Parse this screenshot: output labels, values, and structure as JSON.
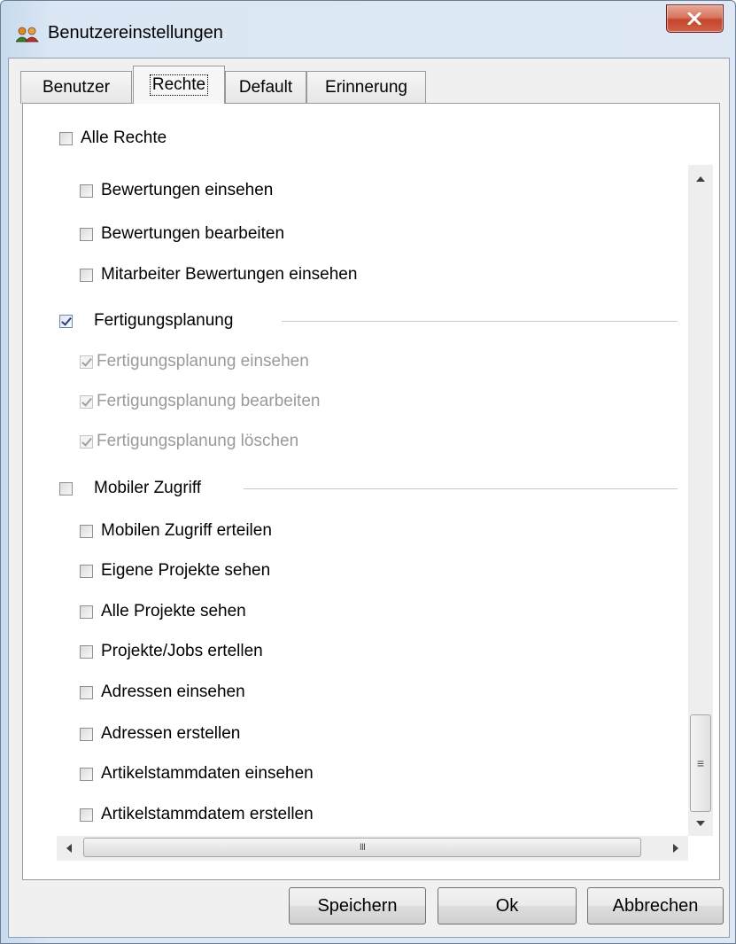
{
  "window": {
    "title": "Benutzereinstellungen",
    "icon": "users-icon",
    "close_icon": "close-icon"
  },
  "tabs": [
    {
      "label": "Benutzer",
      "active": false
    },
    {
      "label": "Rechte",
      "active": true
    },
    {
      "label": "Default",
      "active": false
    },
    {
      "label": "Erinnerung",
      "active": false
    }
  ],
  "all_rights": {
    "label": "Alle Rechte",
    "checked": false
  },
  "permissions": {
    "bewertungen_einsehen": {
      "label": "Bewertungen einsehen",
      "checked": false
    },
    "bewertungen_bearbeiten": {
      "label": "Bewertungen bearbeiten",
      "checked": false
    },
    "mitarbeiter_bewertungen": {
      "label": "Mitarbeiter Bewertungen einsehen",
      "checked": false
    }
  },
  "groups": {
    "fertigung": {
      "label": "Fertigungsplanung",
      "checked": true,
      "items": [
        {
          "label": "Fertigungsplanung einsehen",
          "checked": true,
          "enabled": false
        },
        {
          "label": "Fertigungsplanung bearbeiten",
          "checked": true,
          "enabled": false
        },
        {
          "label": "Fertigungsplanung löschen",
          "checked": true,
          "enabled": false
        }
      ]
    },
    "mobil": {
      "label": "Mobiler Zugriff",
      "checked": false,
      "items": [
        {
          "label": "Mobilen Zugriff erteilen",
          "checked": false
        },
        {
          "label": "Eigene Projekte sehen",
          "checked": false
        },
        {
          "label": "Alle Projekte sehen",
          "checked": false
        },
        {
          "label": "Projekte/Jobs ertellen",
          "checked": false
        },
        {
          "label": "Adressen einsehen",
          "checked": false
        },
        {
          "label": "Adressen erstellen",
          "checked": false
        },
        {
          "label": "Artikelstammdaten einsehen",
          "checked": false
        },
        {
          "label": "Artikelstammdatem erstellen",
          "checked": false
        }
      ]
    }
  },
  "scroll": {
    "vertical_thumb_grip": "≡",
    "horizontal_thumb_grip": "III"
  },
  "buttons": {
    "save": "Speichern",
    "ok": "Ok",
    "cancel": "Abbrechen"
  },
  "colors": {
    "title_gradient": "#c7daee",
    "close_button": "#c4452a",
    "checkbox_check": "#2c3e77",
    "disabled_text": "#9a9a9a"
  }
}
